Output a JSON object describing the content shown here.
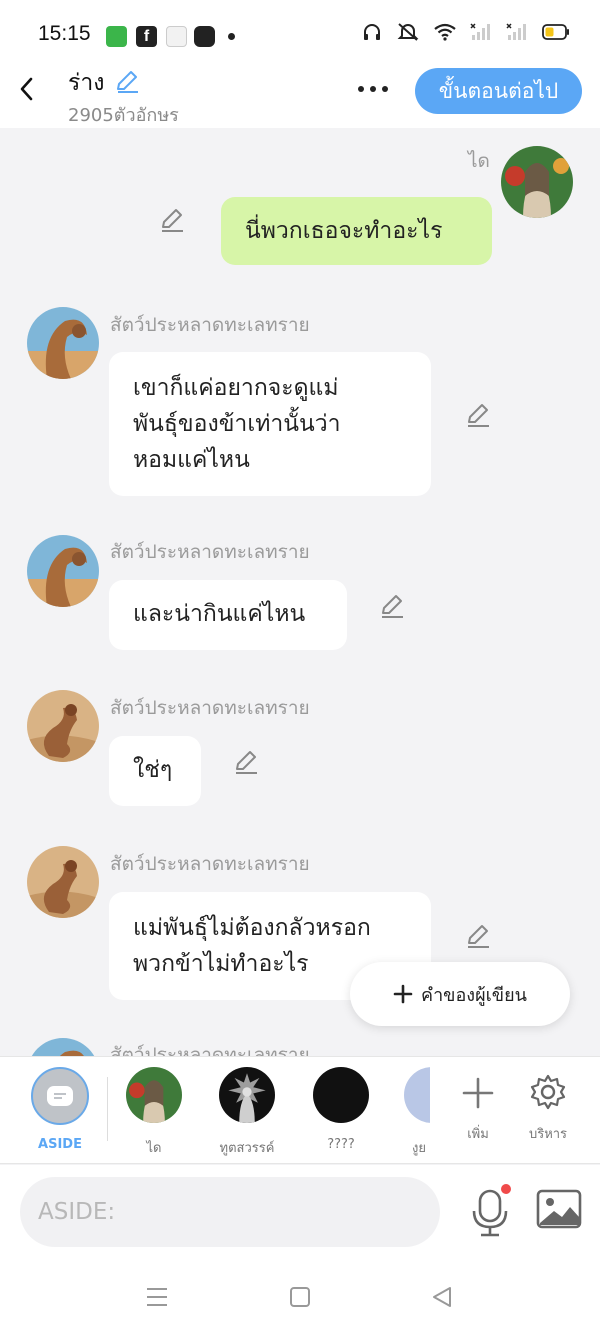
{
  "status_bar": {
    "time": "15:15",
    "icons": [
      "wechat-icon",
      "facebook-icon",
      "game-icon",
      "app-icon",
      "dot-icon",
      "headphones-icon",
      "mute-icon",
      "wifi-icon",
      "signal-icon",
      "signal-icon",
      "battery-icon"
    ]
  },
  "header": {
    "title": "ร่าง",
    "char_count": "2905ตัวอักษร",
    "next_label": "ขั้นตอนต่อไป"
  },
  "messages": [
    {
      "sender": "ได",
      "text": "นี่พวกเธอจะทำอะไร",
      "side": "right"
    },
    {
      "sender": "สัตว์ประหลาดทะเลทราย",
      "lines": [
        "เขาก็แค่อยากจะดูแม่",
        "พันธุ์ของข้าเท่านั้นว่า",
        "หอมแค่ไหน"
      ],
      "side": "left"
    },
    {
      "sender": "สัตว์ประหลาดทะเลทราย",
      "text": "และน่ากินแค่ไหน",
      "side": "left"
    },
    {
      "sender": "สัตว์ประหลาดทะเลทราย",
      "text": "ใช่ๆ",
      "side": "left"
    },
    {
      "sender": "สัตว์ประหลาดทะเลทราย",
      "lines": [
        "แม่พันธุ์ไม่ต้องกลัวหรอก",
        "พวกข้าไม่ทำอะไร"
      ],
      "side": "left"
    },
    {
      "sender": "สัตว์ประหลาดทะเลทราย",
      "side": "left"
    }
  ],
  "fab": {
    "label": "คำของผู้เขียน"
  },
  "characters": [
    {
      "label": "ASIDE"
    },
    {
      "label": "ได"
    },
    {
      "label": "ทูตสวรรค์"
    },
    {
      "label": "????"
    },
    {
      "label": "งูย"
    }
  ],
  "actions": {
    "add_label": "เพิ่ม",
    "manage_label": "บริหาร"
  },
  "input": {
    "placeholder": "ASIDE:"
  },
  "colors": {
    "accent": "#5ba7f5",
    "bubble_self": "#d7f5a8",
    "background": "#f3f3f5"
  }
}
